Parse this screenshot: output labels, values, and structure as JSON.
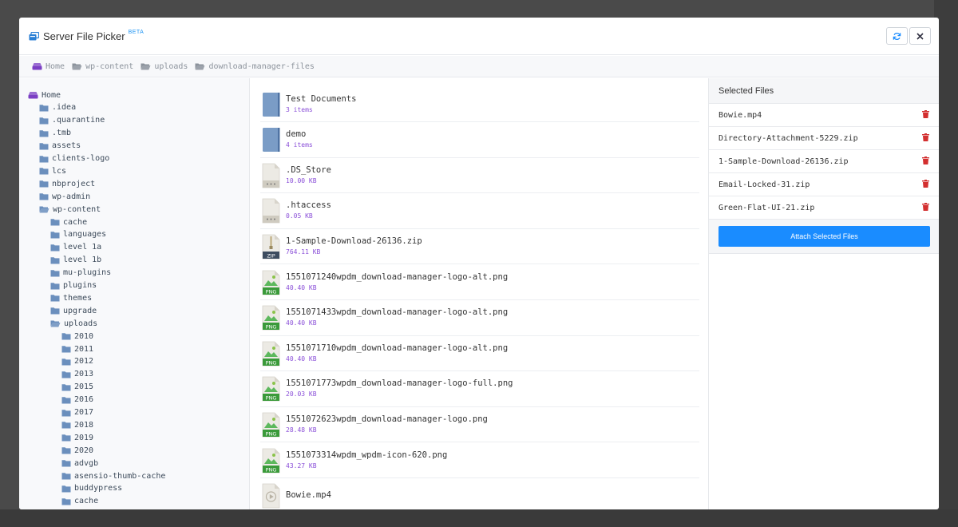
{
  "modal": {
    "title": "Server File Picker",
    "badge": "BETA"
  },
  "breadcrumb": [
    "Home",
    "wp-content",
    "uploads",
    "download-manager-files"
  ],
  "tree": [
    {
      "label": "Home",
      "depth": 0,
      "type": "home"
    },
    {
      "label": ".idea",
      "depth": 1,
      "type": "folder"
    },
    {
      "label": ".quarantine",
      "depth": 1,
      "type": "folder"
    },
    {
      "label": ".tmb",
      "depth": 1,
      "type": "folder"
    },
    {
      "label": "assets",
      "depth": 1,
      "type": "folder"
    },
    {
      "label": "clients-logo",
      "depth": 1,
      "type": "folder"
    },
    {
      "label": "lcs",
      "depth": 1,
      "type": "folder"
    },
    {
      "label": "nbproject",
      "depth": 1,
      "type": "folder"
    },
    {
      "label": "wp-admin",
      "depth": 1,
      "type": "folder"
    },
    {
      "label": "wp-content",
      "depth": 1,
      "type": "open"
    },
    {
      "label": "cache",
      "depth": 2,
      "type": "folder"
    },
    {
      "label": "languages",
      "depth": 2,
      "type": "folder"
    },
    {
      "label": "level 1a",
      "depth": 2,
      "type": "folder"
    },
    {
      "label": "level 1b",
      "depth": 2,
      "type": "folder"
    },
    {
      "label": "mu-plugins",
      "depth": 2,
      "type": "folder"
    },
    {
      "label": "plugins",
      "depth": 2,
      "type": "folder"
    },
    {
      "label": "themes",
      "depth": 2,
      "type": "folder"
    },
    {
      "label": "upgrade",
      "depth": 2,
      "type": "folder"
    },
    {
      "label": "uploads",
      "depth": 2,
      "type": "open"
    },
    {
      "label": "2010",
      "depth": 3,
      "type": "folder"
    },
    {
      "label": "2011",
      "depth": 3,
      "type": "folder"
    },
    {
      "label": "2012",
      "depth": 3,
      "type": "folder"
    },
    {
      "label": "2013",
      "depth": 3,
      "type": "folder"
    },
    {
      "label": "2015",
      "depth": 3,
      "type": "folder"
    },
    {
      "label": "2016",
      "depth": 3,
      "type": "folder"
    },
    {
      "label": "2017",
      "depth": 3,
      "type": "folder"
    },
    {
      "label": "2018",
      "depth": 3,
      "type": "folder"
    },
    {
      "label": "2019",
      "depth": 3,
      "type": "folder"
    },
    {
      "label": "2020",
      "depth": 3,
      "type": "folder"
    },
    {
      "label": "advgb",
      "depth": 3,
      "type": "folder"
    },
    {
      "label": "asensio-thumb-cache",
      "depth": 3,
      "type": "folder"
    },
    {
      "label": "buddypress",
      "depth": 3,
      "type": "folder"
    },
    {
      "label": "cache",
      "depth": 3,
      "type": "folder"
    }
  ],
  "files": [
    {
      "name": "Test Documents",
      "meta": "3 items",
      "type": "folder"
    },
    {
      "name": "demo",
      "meta": "4 items",
      "type": "folder"
    },
    {
      "name": ".DS_Store",
      "meta": "10.00 KB",
      "type": "generic"
    },
    {
      "name": ".htaccess",
      "meta": "0.05 KB",
      "type": "generic"
    },
    {
      "name": "1-Sample-Download-26136.zip",
      "meta": "764.11 KB",
      "type": "zip"
    },
    {
      "name": "1551071240wpdm_download-manager-logo-alt.png",
      "meta": "40.40 KB",
      "type": "png"
    },
    {
      "name": "1551071433wpdm_download-manager-logo-alt.png",
      "meta": "40.40 KB",
      "type": "png"
    },
    {
      "name": "1551071710wpdm_download-manager-logo-alt.png",
      "meta": "40.40 KB",
      "type": "png"
    },
    {
      "name": "1551071773wpdm_download-manager-logo-full.png",
      "meta": "20.03 KB",
      "type": "png"
    },
    {
      "name": "1551072623wpdm_download-manager-logo.png",
      "meta": "28.48 KB",
      "type": "png"
    },
    {
      "name": "1551073314wpdm_wpdm-icon-620.png",
      "meta": "43.27 KB",
      "type": "png"
    },
    {
      "name": "Bowie.mp4",
      "meta": "",
      "type": "video"
    }
  ],
  "selected": {
    "heading": "Selected Files",
    "items": [
      "Bowie.mp4",
      "Directory-Attachment-5229.zip",
      "1-Sample-Download-26136.zip",
      "Email-Locked-31.zip",
      "Green-Flat-UI-21.zip"
    ],
    "attach_label": "Attach Selected Files"
  },
  "colors": {
    "accent": "#1a8cff",
    "folder": "#6b8fbd",
    "home": "#7b3fc4",
    "meta": "#8a4fd8",
    "delete": "#d32f2f"
  },
  "icons": {
    "refresh": "refresh-icon",
    "close": "close-icon",
    "delete": "trash-icon"
  }
}
